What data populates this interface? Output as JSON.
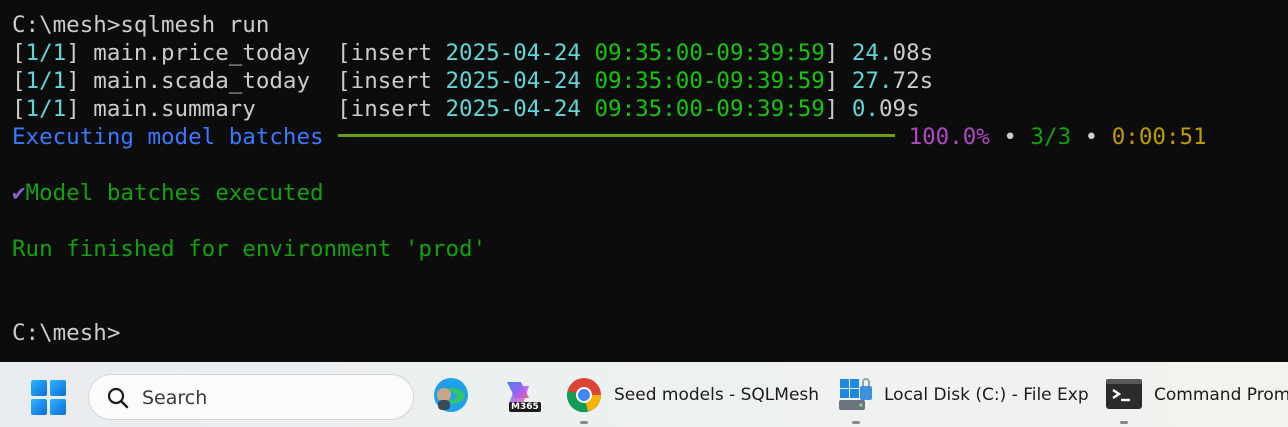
{
  "terminal": {
    "prompt_cmd": "C:\\mesh>sqlmesh run",
    "rows": [
      {
        "counter_open": "[",
        "counter": "1/1",
        "counter_close": "]",
        "model": " main.price_today  [insert ",
        "date": "2025-04-24",
        "time": "09:35:00-09:39:59",
        "close": "] ",
        "dur_int": "24.",
        "dur_rest": "08s"
      },
      {
        "counter_open": "[",
        "counter": "1/1",
        "counter_close": "]",
        "model": " main.scada_today  [insert ",
        "date": "2025-04-24",
        "time": "09:35:00-09:39:59",
        "close": "] ",
        "dur_int": "27.",
        "dur_rest": "72s"
      },
      {
        "counter_open": "[",
        "counter": "1/1",
        "counter_close": "]",
        "model": " main.summary      [insert ",
        "date": "2025-04-24",
        "time": "09:35:00-09:39:59",
        "close": "] ",
        "dur_int": "0.",
        "dur_rest": "09s"
      }
    ],
    "progress": {
      "label": "Executing model batches",
      "fraction": 1.0,
      "percent": "100.0%",
      "sep1": " • ",
      "count": "3/3",
      "sep2": " • ",
      "elapsed": "0:00:51"
    },
    "check_glyph": "✔",
    "batches_msg": "Model batches executed",
    "run_msg": "Run finished for environment 'prod'",
    "final_prompt": "C:\\mesh>"
  },
  "taskbar": {
    "search_placeholder": "Search",
    "copilot_badge": "M365",
    "apps": [
      {
        "label": "Seed models - SQLMesh",
        "icon": "chrome-icon"
      },
      {
        "label": "Local Disk (C:) - File Exp",
        "icon": "file-explorer-icon"
      },
      {
        "label": "Command Prompt",
        "icon": "command-prompt-icon"
      }
    ]
  },
  "colors": {
    "background": "#0c0c0c",
    "date": "#61d6d6",
    "time": "#16c60c",
    "progress_label": "#3b78ff",
    "percent": "#b148c6",
    "count": "#13a10e",
    "elapsed": "#c19c00",
    "bar": "#6a9f12"
  }
}
